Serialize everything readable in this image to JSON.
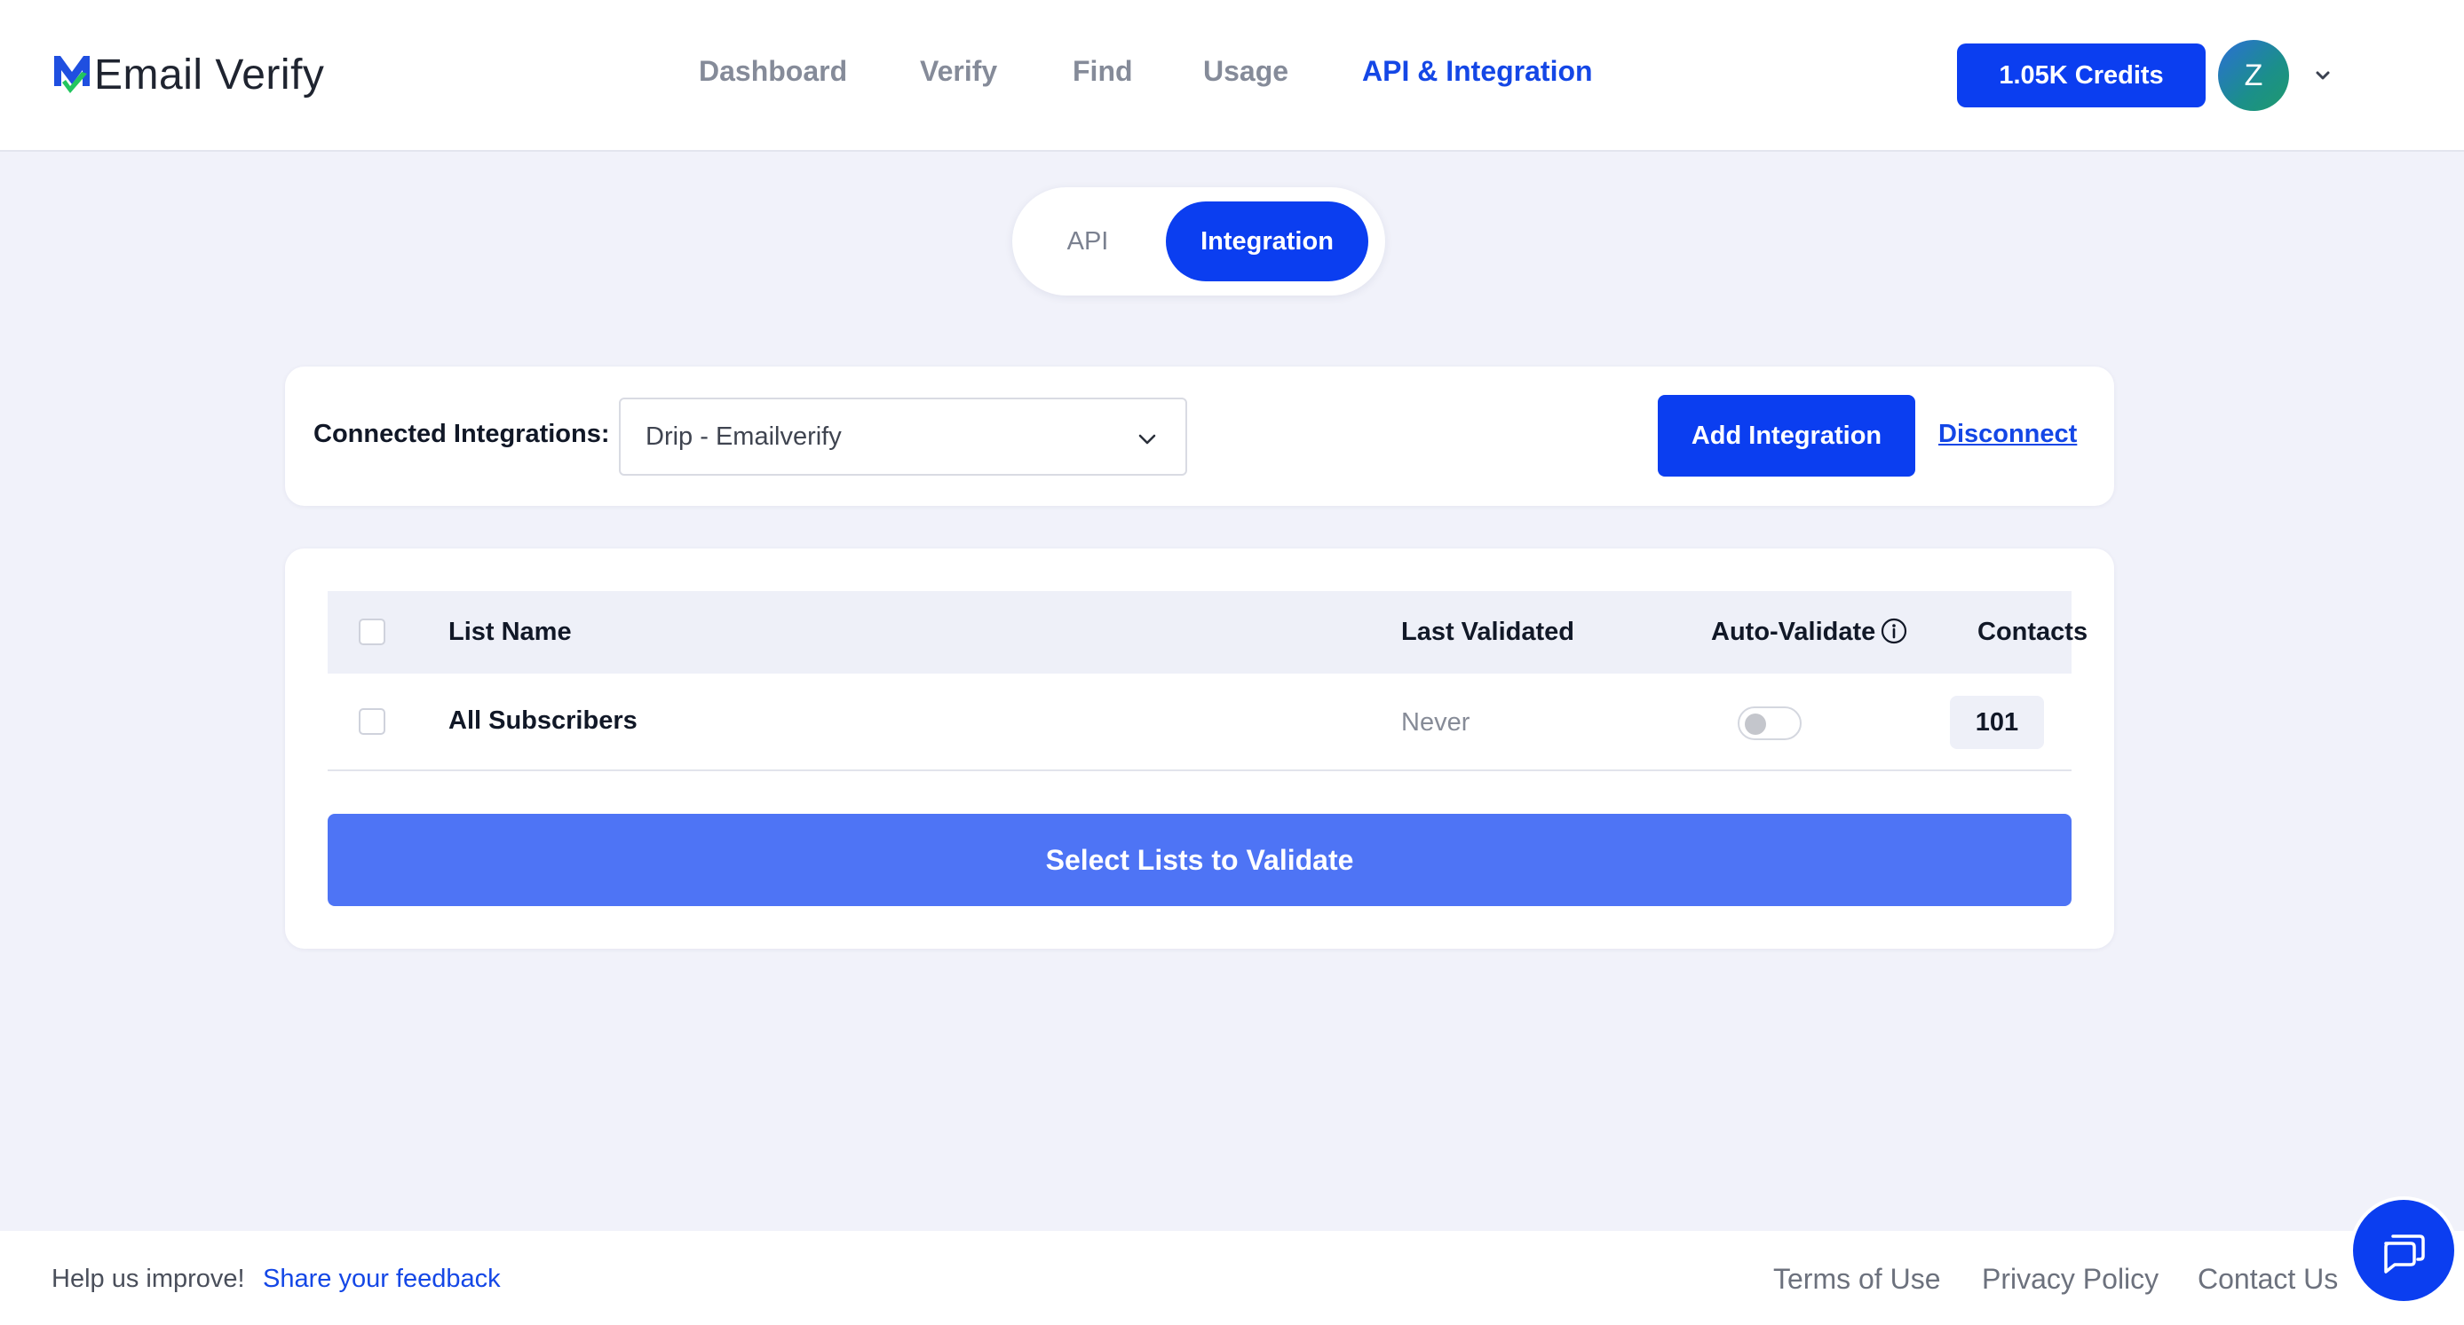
{
  "brand": {
    "name": "Email Verify",
    "logo_letter": "M"
  },
  "nav": {
    "items": [
      {
        "label": "Dashboard",
        "active": false
      },
      {
        "label": "Verify",
        "active": false
      },
      {
        "label": "Find",
        "active": false
      },
      {
        "label": "Usage",
        "active": false
      },
      {
        "label": "API & Integration",
        "active": true
      }
    ]
  },
  "account": {
    "credits_label": "1.05K Credits",
    "avatar_initial": "Z"
  },
  "tabs": {
    "api": "API",
    "integration": "Integration",
    "active": "Integration"
  },
  "integrations": {
    "label": "Connected Integrations:",
    "selected": "Drip - Emailverify",
    "add_button": "Add Integration",
    "disconnect_link": "Disconnect"
  },
  "table": {
    "headers": {
      "list_name": "List Name",
      "last_validated": "Last Validated",
      "auto_validate": "Auto-Validate",
      "contacts": "Contacts"
    },
    "rows": [
      {
        "list_name": "All Subscribers",
        "last_validated": "Never",
        "auto_validate": false,
        "contacts": "101"
      }
    ]
  },
  "validate_button": "Select Lists to Validate",
  "footer": {
    "help_text": "Help us improve!",
    "feedback_link": "Share your feedback",
    "links": [
      "Terms of Use",
      "Privacy Policy",
      "Contact Us"
    ]
  },
  "colors": {
    "primary": "#0b3ef0",
    "active_nav": "#1447e6",
    "validate_button": "#4e74f5",
    "background": "#f1f2fa"
  }
}
